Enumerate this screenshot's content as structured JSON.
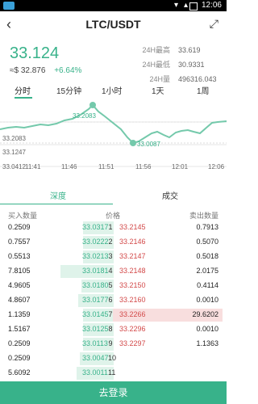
{
  "status_bar": {
    "time": "12:06"
  },
  "header": {
    "title": "LTC/USDT"
  },
  "ticker": {
    "last_price": "33.124",
    "approx_fiat": "≈$ 32.876",
    "change_pct": "+6.64%"
  },
  "stats": {
    "high_label": "24H最高",
    "high": "33.619",
    "low_label": "24H最低",
    "low": "30.9331",
    "vol_label": "24H量",
    "volume": "496316.043"
  },
  "intervals": [
    "分时",
    "15分钟",
    "1小时",
    "1天",
    "1周"
  ],
  "chart_labels": {
    "y_labels": [
      "33.2083",
      "33.1247",
      "33.0412"
    ],
    "x_labels": [
      "11:41",
      "11:46",
      "11:51",
      "11:56",
      "12:01",
      "12:06"
    ],
    "high_mark": "33.2083",
    "low_mark": "33.0087"
  },
  "book": {
    "tab_depth": "深度",
    "tab_trades": "成交",
    "col_buy_qty": "买入数量",
    "col_price": "价格",
    "col_sell_qty": "卖出数量",
    "rows": [
      {
        "idx": "1",
        "bid_qty": "0.2509",
        "bid_price": "33.0317",
        "ask_price": "33.2145",
        "ask_qty": "0.7913",
        "bid_fill": 0.28,
        "ask_fill": 0.1
      },
      {
        "idx": "2",
        "bid_qty": "0.7557",
        "bid_price": "33.0222",
        "ask_price": "33.2146",
        "ask_qty": "0.5070",
        "bid_fill": 0.28,
        "ask_fill": 0.1
      },
      {
        "idx": "3",
        "bid_qty": "0.5513",
        "bid_price": "33.0213",
        "ask_price": "33.2147",
        "ask_qty": "0.5018",
        "bid_fill": 0.28,
        "ask_fill": 0.1
      },
      {
        "idx": "4",
        "bid_qty": "7.8105",
        "bid_price": "33.0181",
        "ask_price": "33.2148",
        "ask_qty": "2.0175",
        "bid_fill": 0.5,
        "ask_fill": 0.12
      },
      {
        "idx": "5",
        "bid_qty": "4.9605",
        "bid_price": "33.0180",
        "ask_price": "33.2150",
        "ask_qty": "0.4114",
        "bid_fill": 0.3,
        "ask_fill": 0.1
      },
      {
        "idx": "6",
        "bid_qty": "4.8607",
        "bid_price": "33.0177",
        "ask_price": "33.2160",
        "ask_qty": "0.0010",
        "bid_fill": 0.32,
        "ask_fill": 0.1
      },
      {
        "idx": "7",
        "bid_qty": "1.1359",
        "bid_price": "33.0145",
        "ask_price": "33.2266",
        "ask_qty": "29.6202",
        "bid_fill": 0.28,
        "ask_fill": 0.98
      },
      {
        "idx": "8",
        "bid_qty": "1.5167",
        "bid_price": "33.0125",
        "ask_price": "33.2296",
        "ask_qty": "0.0010",
        "bid_fill": 0.3,
        "ask_fill": 0.0
      },
      {
        "idx": "9",
        "bid_qty": "0.2509",
        "bid_price": "33.0113",
        "ask_price": "33.2297",
        "ask_qty": "1.1363",
        "bid_fill": 0.28,
        "ask_fill": 0.0
      },
      {
        "idx": "10",
        "bid_qty": "0.2509",
        "bid_price": "33.0047",
        "ask_price": "",
        "ask_qty": "",
        "bid_fill": 0.32,
        "ask_fill": 0.0
      },
      {
        "idx": "11",
        "bid_qty": "5.6092",
        "bid_price": "33.0011",
        "ask_price": "",
        "ask_qty": "",
        "bid_fill": 0.36,
        "ask_fill": 0.0
      }
    ]
  },
  "actions": {
    "login": "去登录"
  },
  "colors": {
    "accent": "#38b28a",
    "ask": "#d34a4a"
  }
}
